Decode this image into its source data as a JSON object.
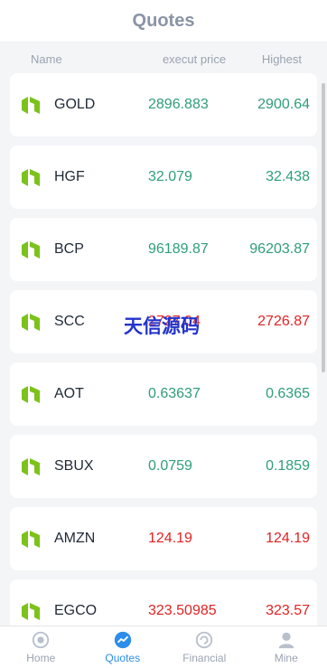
{
  "header": {
    "title": "Quotes"
  },
  "columns": {
    "name": "Name",
    "price": "execut price",
    "high": "Highest"
  },
  "rows": [
    {
      "symbol": "GOLD",
      "price": "2896.883",
      "high": "2900.64",
      "status": "up"
    },
    {
      "symbol": "HGF",
      "price": "32.079",
      "high": "32.438",
      "status": "up"
    },
    {
      "symbol": "BCP",
      "price": "96189.87",
      "high": "96203.87",
      "status": "up"
    },
    {
      "symbol": "SCC",
      "price": "2727.04",
      "high": "2726.87",
      "status": "down"
    },
    {
      "symbol": "AOT",
      "price": "0.63637",
      "high": "0.6365",
      "status": "up"
    },
    {
      "symbol": "SBUX",
      "price": "0.0759",
      "high": "0.1859",
      "status": "up"
    },
    {
      "symbol": "AMZN",
      "price": "124.19",
      "high": "124.19",
      "status": "down"
    },
    {
      "symbol": "EGCO",
      "price": "323.50985",
      "high": "323.57",
      "status": "down"
    }
  ],
  "watermark": "天信源码",
  "tabs": [
    {
      "label": "Home",
      "icon": "home-icon"
    },
    {
      "label": "Quotes",
      "icon": "chart-trend-icon"
    },
    {
      "label": "Financial",
      "icon": "financial-icon"
    },
    {
      "label": "Mine",
      "icon": "user-icon"
    }
  ],
  "colors": {
    "up": "#2e9e7a",
    "down": "#e32222",
    "accent": "#2c8eea",
    "logo": "#7cc21a"
  }
}
